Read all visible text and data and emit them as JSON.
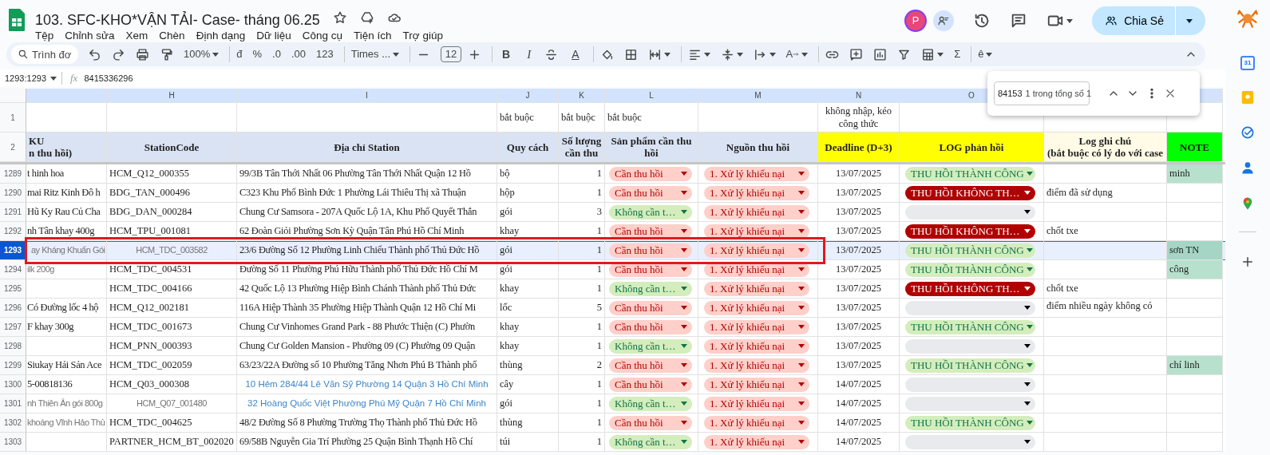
{
  "document": {
    "title": "103. SFC-KHO*VẬN TẢI- Case- tháng 06.25"
  },
  "menu": [
    "Tệp",
    "Chỉnh sửa",
    "Xem",
    "Chèn",
    "Định dạng",
    "Dữ liệu",
    "Công cụ",
    "Tiện ích",
    "Trợ giúp"
  ],
  "account": {
    "avatar": "P",
    "share_label": "Chia Sẻ"
  },
  "toolbar": [
    [
      {
        "kind": "search",
        "placeholder": "Trình đơ"
      },
      {
        "kind": "undo"
      },
      {
        "kind": "redo"
      },
      {
        "kind": "print"
      },
      {
        "kind": "paint"
      },
      {
        "kind": "text",
        "text": "100%",
        "dropdown": true
      }
    ],
    [
      {
        "kind": "text",
        "text": "đ"
      },
      {
        "kind": "text",
        "text": "%"
      },
      {
        "kind": "text",
        "text": ".0"
      },
      {
        "kind": "text",
        "text": ".00"
      },
      {
        "kind": "text",
        "text": "123"
      }
    ],
    [
      {
        "kind": "text",
        "text": "Times ...",
        "dropdown": true
      }
    ],
    [
      {
        "kind": "minus"
      },
      {
        "kind": "size",
        "text": "12"
      },
      {
        "kind": "plus"
      }
    ],
    [
      {
        "kind": "bold",
        "text": "B"
      },
      {
        "kind": "italic",
        "text": "I"
      },
      {
        "kind": "strike"
      },
      {
        "kind": "textcolor",
        "text": "A"
      }
    ],
    [
      {
        "kind": "fill"
      },
      {
        "kind": "borders"
      },
      {
        "kind": "merge",
        "dropdown": true
      }
    ],
    [
      {
        "kind": "halign",
        "dropdown": true
      },
      {
        "kind": "valign",
        "dropdown": true
      },
      {
        "kind": "wrap",
        "dropdown": true
      },
      {
        "kind": "rotate",
        "text": "A",
        "dropdown": true
      }
    ],
    [
      {
        "kind": "link"
      },
      {
        "kind": "comment"
      },
      {
        "kind": "chart"
      },
      {
        "kind": "filter"
      },
      {
        "kind": "table",
        "dropdown": true
      },
      {
        "kind": "text",
        "text": "Σ"
      }
    ],
    [
      {
        "kind": "text",
        "text": "ê",
        "dropdown": true
      }
    ]
  ],
  "formula_bar": {
    "name_box": "1293:1293",
    "fx": "fx",
    "value": "8415336296"
  },
  "find": {
    "value": "84153",
    "count": "1 trong tổng số 1"
  },
  "columns": [
    {},
    {
      "letter": "H"
    },
    {
      "letter": "I"
    },
    {
      "letter": "J"
    },
    {
      "letter": "K"
    },
    {
      "letter": "L"
    },
    {
      "letter": "M"
    },
    {
      "letter": "N"
    },
    {
      "letter": "O"
    },
    {},
    {}
  ],
  "row1": {
    "number": "1",
    "cells": [
      "",
      "",
      "",
      "bắt buộc",
      "bắt buộc",
      "bắt buộc",
      "",
      "không nhập, kéo công thức",
      "",
      "",
      ""
    ]
  },
  "header_row": {
    "number": "2",
    "cells": [
      {
        "text": "KU\nn thu hồi)",
        "color": "#dae3f3"
      },
      {
        "text": "StationCode",
        "color": "#dae3f3"
      },
      {
        "text": "Địa chỉ Station",
        "color": "#dae3f3"
      },
      {
        "text": "Quy cách",
        "color": "#dae3f3"
      },
      {
        "text": "Số lượng cần thu",
        "color": "#dae3f3"
      },
      {
        "text": "Sản phẩm cần thu hồi",
        "color": "#dae3f3"
      },
      {
        "text": "Nguồn thu hồi",
        "color": "#dae3f3"
      },
      {
        "text": "Deadline (D+3)",
        "color": "#ffff00"
      },
      {
        "text": "LOG phản hồi",
        "color": "#ffff00"
      },
      {
        "text": "Log ghi chú\n(bắt buộc có lý do với case",
        "color": "#fffbe6"
      },
      {
        "text": "NOTE",
        "color": "#00ff00"
      }
    ]
  },
  "rows": [
    {
      "number": "1289",
      "selected": false,
      "outlined": false,
      "sku": {
        "kind": "normal",
        "text": "t hinh hoa"
      },
      "station_code": {
        "kind": "normal",
        "text": "HCM_Q12_000355"
      },
      "address": {
        "kind": "normal",
        "text": "99/3B Tân Thới Nhất 06 Phường Tân Thới Nhất Quận 12 Hồ"
      },
      "unit": "bộ",
      "qty": "1",
      "product": {
        "kind": "required",
        "text": "Cần thu hồi"
      },
      "source": "1. Xử lý khiếu nại",
      "deadline": "13/07/2025",
      "log": {
        "kind": "success",
        "text": "THU HỒI THÀNH CÔNG"
      },
      "note": "minh"
    },
    {
      "number": "1290",
      "selected": false,
      "outlined": false,
      "sku": {
        "kind": "normal",
        "text": "mai Ritz Kinh Đô h"
      },
      "station_code": {
        "kind": "normal",
        "text": "BDG_TAN_000496"
      },
      "address": {
        "kind": "normal",
        "text": "C323 Khu Phố Bình Đức 1 Phường Lái Thiêu Thị xã Thuận"
      },
      "unit": "hộp",
      "qty": "1",
      "product": {
        "kind": "required",
        "text": "Cần thu hồi"
      },
      "source": "1. Xử lý khiếu nại",
      "deadline": "13/07/2025",
      "log": {
        "kind": "failed",
        "text": "THU HỒI KHÔNG TH…"
      },
      "log_note": "điểm đã sử dụng"
    },
    {
      "number": "1291",
      "selected": false,
      "outlined": false,
      "sku": {
        "kind": "normal",
        "text": "Hũ Ky Rau Củ Cha"
      },
      "station_code": {
        "kind": "normal",
        "text": "BDG_DAN_000284"
      },
      "address": {
        "kind": "normal",
        "text": "Chung Cư Samsora - 207A Quốc Lộ 1A, Khu Phố Quyết Thắn"
      },
      "unit": "gói",
      "qty": "3",
      "product": {
        "kind": "not_required",
        "text": "Không cần t…"
      },
      "source": "1. Xử lý khiếu nại",
      "deadline": "13/07/2025",
      "log": {
        "kind": "empty"
      }
    },
    {
      "number": "1292",
      "selected": false,
      "outlined": false,
      "sku": {
        "kind": "normal",
        "text": "nh Tân khay 400g"
      },
      "station_code": {
        "kind": "normal",
        "text": "HCM_TPU_001081"
      },
      "address": {
        "kind": "normal",
        "text": "62 Đoàn Giỏi Phường Sơn Kỳ Quận Tân Phú Hồ Chí Minh"
      },
      "unit": "khay",
      "qty": "1",
      "product": {
        "kind": "required",
        "text": "Cần thu hồi"
      },
      "source": "1. Xử lý khiếu nại",
      "deadline": "13/07/2025",
      "log": {
        "kind": "failed",
        "text": "THU HỒI KHÔNG TH…"
      },
      "log_note": "chốt txe"
    },
    {
      "number": "1293",
      "selected": true,
      "outlined": true,
      "sku": {
        "kind": "pasted",
        "text": "ay Kháng Khuẩn Gói"
      },
      "station_code": {
        "kind": "pasted",
        "text": "HCM_TDC_003582"
      },
      "address": {
        "kind": "normal",
        "text": "23/6 Đường Số 12 Phường Linh Chiểu Thành phố Thủ Đức Hồ"
      },
      "unit": "gói",
      "qty": "1",
      "product": {
        "kind": "required",
        "text": "Cần thu hồi"
      },
      "source": "1. Xử lý khiếu nại",
      "deadline": "13/07/2025",
      "log": {
        "kind": "success",
        "text": "THU HỒI THÀNH CÔNG"
      },
      "note": "sơn TN"
    },
    {
      "number": "1294",
      "selected": false,
      "outlined": false,
      "sku": {
        "kind": "pasted",
        "text": "ilk 200g"
      },
      "station_code": {
        "kind": "normal",
        "text": "HCM_TDC_004531"
      },
      "address": {
        "kind": "normal",
        "text": "Đường Số 11 Phường Phú Hữu Thành phố Thủ Đức Hồ Chí M"
      },
      "unit": "gói",
      "qty": "1",
      "product": {
        "kind": "required",
        "text": "Cần thu hồi"
      },
      "source": "1. Xử lý khiếu nại",
      "deadline": "13/07/2025",
      "log": {
        "kind": "success",
        "text": "THU HỒI THÀNH CÔNG"
      },
      "note": "công"
    },
    {
      "number": "1295",
      "selected": false,
      "outlined": false,
      "station_code": {
        "kind": "normal",
        "text": "HCM_TDC_004166"
      },
      "address": {
        "kind": "normal",
        "text": "42 Quốc Lộ 13 Phường Hiệp Bình Chánh Thành phố Thủ Đức"
      },
      "unit": "khay",
      "qty": "1",
      "product": {
        "kind": "not_required",
        "text": "Không cần t…"
      },
      "source": "1. Xử lý khiếu nại",
      "deadline": "13/07/2025",
      "log": {
        "kind": "failed",
        "text": "THU HỒI KHÔNG TH…"
      },
      "log_note": "chốt txe"
    },
    {
      "number": "1296",
      "selected": false,
      "outlined": false,
      "sku": {
        "kind": "normal",
        "text": "Có Đường lốc 4 hộ"
      },
      "station_code": {
        "kind": "normal",
        "text": "HCM_Q12_002181"
      },
      "address": {
        "kind": "normal",
        "text": "116A Hiệp Thành 35 Phường Hiệp Thành Quận 12 Hồ Chí Mi"
      },
      "unit": "lốc",
      "qty": "5",
      "product": {
        "kind": "required",
        "text": "Cần thu hồi"
      },
      "source": "1. Xử lý khiếu nại",
      "deadline": "13/07/2025",
      "log": {
        "kind": "empty"
      },
      "log_note": "điểm nhiều ngày không có"
    },
    {
      "number": "1297",
      "selected": false,
      "outlined": false,
      "sku": {
        "kind": "normal",
        "text": "F khay 300g"
      },
      "station_code": {
        "kind": "normal",
        "text": "HCM_TDC_001673"
      },
      "address": {
        "kind": "normal",
        "text": "Chung Cư Vinhomes Grand Park - 88 Phước Thiện (C) Phườn"
      },
      "unit": "khay",
      "qty": "1",
      "product": {
        "kind": "required",
        "text": "Cần thu hồi"
      },
      "source": "1. Xử lý khiếu nại",
      "deadline": "13/07/2025",
      "log": {
        "kind": "success",
        "text": "THU HỒI THÀNH CÔNG"
      }
    },
    {
      "number": "1298",
      "selected": false,
      "outlined": false,
      "station_code": {
        "kind": "normal",
        "text": "HCM_PNN_000393"
      },
      "address": {
        "kind": "normal",
        "text": "Chung Cư Golden Mansion - Phường 09 (C) Phường 09 Quận"
      },
      "unit": "khay",
      "qty": "1",
      "product": {
        "kind": "not_required",
        "text": "Không cần t…"
      },
      "source": "1. Xử lý khiếu nại",
      "deadline": "13/07/2025",
      "log": {
        "kind": "empty"
      }
    },
    {
      "number": "1299",
      "selected": false,
      "outlined": false,
      "sku": {
        "kind": "normal",
        "text": "Siukay Hải Sản Ace"
      },
      "station_code": {
        "kind": "normal",
        "text": "HCM_TDC_002059"
      },
      "address": {
        "kind": "normal",
        "text": "63/23/22A Đường số 10 Phường Tăng Nhơn Phú B Thành phố"
      },
      "unit": "thùng",
      "qty": "2",
      "product": {
        "kind": "required",
        "text": "Cần thu hồi"
      },
      "source": "1. Xử lý khiếu nại",
      "deadline": "13/07/2025",
      "log": {
        "kind": "success",
        "text": "THU HỒI THÀNH CÔNG"
      },
      "note": "chí linh"
    },
    {
      "number": "1300",
      "selected": false,
      "outlined": false,
      "sku": {
        "kind": "normal",
        "text": "5-00818136"
      },
      "station_code": {
        "kind": "normal",
        "text": "HCM_Q03_000308"
      },
      "address": {
        "kind": "link",
        "text": "10 Hẻm 284/44 Lê Văn Sỹ Phường 14 Quận 3 Hồ Chí Minh"
      },
      "unit": "cây",
      "qty": "1",
      "product": {
        "kind": "required",
        "text": "Cần thu hồi"
      },
      "source": "1. Xử lý khiếu nại",
      "deadline": "14/07/2025",
      "log": {
        "kind": "empty"
      }
    },
    {
      "number": "1301",
      "selected": false,
      "outlined": false,
      "sku": {
        "kind": "pasted",
        "text": "nh Thiên Ân gói 800g"
      },
      "station_code": {
        "kind": "pasted",
        "text": "HCM_Q07_001480"
      },
      "address": {
        "kind": "link",
        "text": "32 Hoàng Quốc Việt Phường Phú Mỹ Quận 7 Hồ Chí Minh"
      },
      "unit": "gói",
      "qty": "1",
      "product": {
        "kind": "not_required",
        "text": "Không cần t…"
      },
      "source": "1. Xử lý khiếu nại",
      "deadline": "14/07/2025",
      "log": {
        "kind": "empty"
      }
    },
    {
      "number": "1302",
      "selected": false,
      "outlined": false,
      "sku": {
        "kind": "pasted",
        "text": "khoáng Vĩnh Hảo Thù"
      },
      "station_code": {
        "kind": "normal",
        "text": "HCM_TDC_004625"
      },
      "address": {
        "kind": "normal",
        "text": "48/2 Đường Số 8 Phường Trường Thọ Thành phố Thủ Đức Hồ"
      },
      "unit": "thùng",
      "qty": "1",
      "product": {
        "kind": "required",
        "text": "Cần thu hồi"
      },
      "source": "1. Xử lý khiếu nại",
      "deadline": "14/07/2025",
      "log": {
        "kind": "success",
        "text": "THU HỒI THÀNH CÔNG"
      }
    },
    {
      "number": "1303",
      "selected": false,
      "outlined": false,
      "station_code": {
        "kind": "normal",
        "text": "PARTNER_HCM_BT_002020"
      },
      "address": {
        "kind": "normal",
        "text": "69/58B Nguyễn Gia Trí Phường 25 Quận Bình Thạnh Hồ Chí"
      },
      "unit": "túi",
      "qty": "1",
      "product": {
        "kind": "not_required",
        "text": "Không cần t…"
      },
      "source": "1. Xử lý khiếu nại",
      "deadline": "14/07/2025",
      "log": {
        "kind": "empty"
      }
    }
  ],
  "side_apps": [
    {
      "kind": "calendar",
      "text": "31"
    },
    {
      "kind": "keep"
    },
    {
      "kind": "tasks"
    },
    {
      "kind": "contacts"
    },
    {
      "kind": "maps"
    },
    {
      "kind": "add"
    }
  ]
}
